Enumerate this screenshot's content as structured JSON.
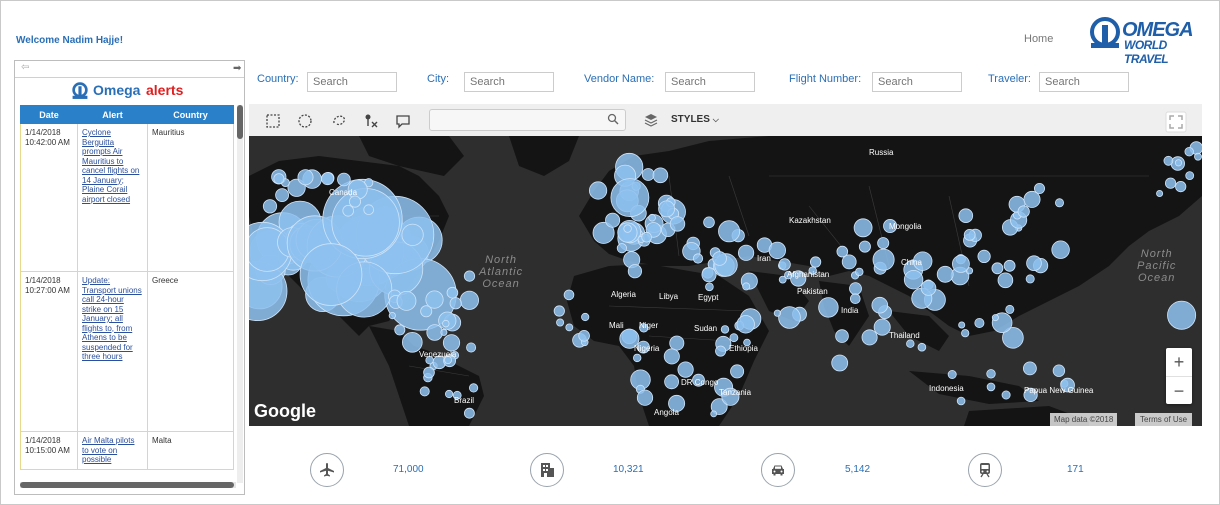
{
  "header": {
    "welcome": "Welcome Nadim Hajje!",
    "home": "Home",
    "logo_top": "OMEGA",
    "logo_bottom": "WORLD TRAVEL"
  },
  "sidebar": {
    "brand_a": "Omega",
    "brand_b": "alerts",
    "columns": [
      "Date",
      "Alert",
      "Country"
    ],
    "rows": [
      {
        "date": "1/14/2018 10:42:00 AM",
        "alert": "Cyclone Berguitta prompts Air Mauritius to cancel flights on 14 January; Plaine Corail airport closed",
        "country": "Mauritius"
      },
      {
        "date": "1/14/2018 10:27:00 AM",
        "alert": "Update: Transport unions call 24-hour strike on 15 January; all flights to, from Athens to be suspended for three hours",
        "country": "Greece"
      },
      {
        "date": "1/14/2018 10:15:00 AM",
        "alert": "Air Malta pilots to vote on possible",
        "country": "Malta"
      }
    ]
  },
  "filters": [
    {
      "label": "Country:",
      "placeholder": "Search"
    },
    {
      "label": "City:",
      "placeholder": "Search"
    },
    {
      "label": "Vendor Name:",
      "placeholder": "Search"
    },
    {
      "label": "Flight Number:",
      "placeholder": "Search"
    },
    {
      "label": "Traveler:",
      "placeholder": "Search"
    }
  ],
  "map": {
    "styles_label": "STYLES",
    "google": "Google",
    "attribution": "Map data ©2018",
    "terms": "Terms of Use",
    "zoom_in": "+",
    "zoom_out": "−",
    "ocean_north_atlantic": [
      "North",
      "Atlantic",
      "Ocean"
    ],
    "ocean_north_pacific": [
      "North",
      "Pacific",
      "Ocean"
    ],
    "labels": [
      "Canada",
      "Russia",
      "Kazakhstan",
      "Mongolia",
      "China",
      "Afghanistan",
      "Pakistan",
      "Algeria",
      "Libya",
      "Egypt",
      "Mali",
      "Niger",
      "Sudan",
      "Nigeria",
      "Ethiopia",
      "DR Congo",
      "Angola",
      "Tanzania",
      "Venezuela",
      "Brazil",
      "Indonesia",
      "Papua New Guinea",
      "Iran",
      "India",
      "Thailand"
    ],
    "accent_color": "#8ec1ef",
    "land_color": "#141414"
  },
  "stats": [
    {
      "icon": "airplane-icon",
      "value": "71,000"
    },
    {
      "icon": "hotel-building-icon",
      "value": "10,321"
    },
    {
      "icon": "car-icon",
      "value": "5,142"
    },
    {
      "icon": "train-icon",
      "value": "171"
    }
  ]
}
